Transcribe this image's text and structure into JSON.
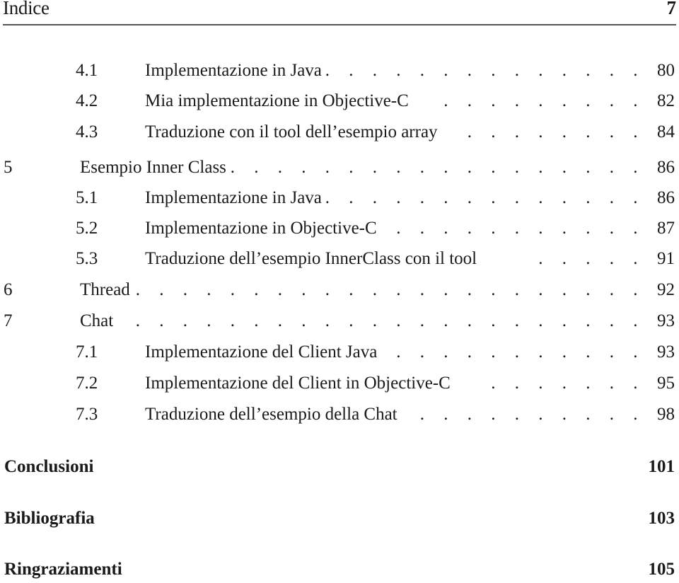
{
  "header": {
    "title": "Indice",
    "page_number": "7"
  },
  "toc": {
    "entries": [
      {
        "level": "section",
        "number": "4.1",
        "title": "Implementazione in Java",
        "leader": ". . . . . . . . . . . . . . . . .",
        "page": "80"
      },
      {
        "level": "section",
        "number": "4.2",
        "title": "Mia implementazione in Objective-C",
        "leader": ". . . . . . . . .",
        "page": "82"
      },
      {
        "level": "section",
        "number": "4.3",
        "title": "Traduzione con il tool dell’esempio array",
        "leader": ". . . . . . . .",
        "page": "84"
      },
      {
        "level": "chapter",
        "number": "5",
        "title": "Esempio Inner Class",
        "leader": ". . . . . . . . . . . . . . . . . . . . . .",
        "page": "86"
      },
      {
        "level": "section",
        "number": "5.1",
        "title": "Implementazione in Java",
        "leader": ". . . . . . . . . . . . . . . . .",
        "page": "86"
      },
      {
        "level": "section",
        "number": "5.2",
        "title": "Implementazione in Objective-C",
        "leader": ". . . . . . . . . . . . .",
        "page": "87"
      },
      {
        "level": "section",
        "number": "5.3",
        "title": "Traduzione dell’esempio InnerClass con il tool",
        "leader": ". . . . .",
        "page": "91"
      },
      {
        "level": "chapter",
        "number": "6",
        "title": "Thread",
        "leader": ". . . . . . . . . . . . . . . . . . . . . . . . . . . . . .",
        "page": "92"
      },
      {
        "level": "chapter",
        "number": "7",
        "title": "Chat",
        "leader": ". . . . . . . . . . . . . . . . . . . . . . . . . . . . . . .",
        "page": "93"
      },
      {
        "level": "section",
        "number": "7.1",
        "title": "Implementazione del Client Java",
        "leader": ". . . . . . . . . . . . .",
        "page": "93"
      },
      {
        "level": "section",
        "number": "7.2",
        "title": "Implementazione del Client in Objective-C",
        "leader": ". . . . . . .",
        "page": "95"
      },
      {
        "level": "section",
        "number": "7.3",
        "title": "Traduzione dell’esempio della Chat",
        "leader": ". . . . . . . . . . .",
        "page": "98"
      }
    ],
    "major_entries": [
      {
        "title": "Conclusioni",
        "page": "101"
      },
      {
        "title": "Bibliografia",
        "page": "103"
      },
      {
        "title": "Ringraziamenti",
        "page": "105"
      }
    ]
  }
}
